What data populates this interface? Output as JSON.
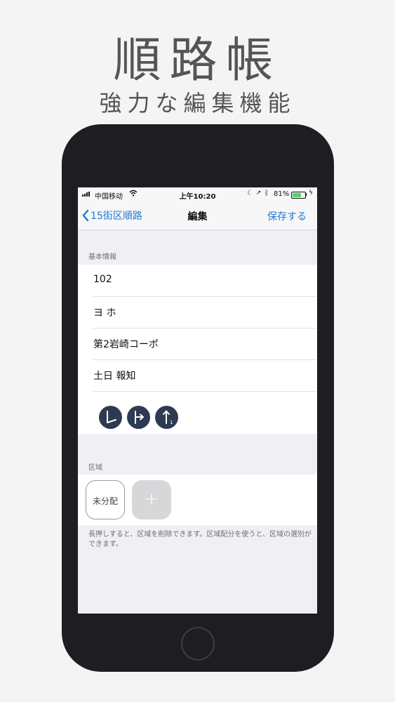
{
  "promo": {
    "title": "順路帳",
    "subtitle": "強力な編集機能"
  },
  "status_bar": {
    "carrier": "中国移动",
    "time": "上午10:20",
    "battery": "81%",
    "battery_level": 0.81,
    "icons": [
      "signal-icon",
      "wifi-icon",
      "moon-icon",
      "location-icon",
      "bluetooth-icon",
      "battery-icon",
      "charging-icon"
    ]
  },
  "nav": {
    "back_label": "15街区順路",
    "title": "編集",
    "save_label": "保存する"
  },
  "basic_info": {
    "header": "基本情報",
    "rows": [
      "102",
      "ヨ ホ",
      "第2岩崎コーポ",
      "土日 報知"
    ],
    "direction_icons": [
      "turn-left-icon",
      "turn-right-icon",
      "go-straight-icon"
    ]
  },
  "area": {
    "header": "区域",
    "unassigned_label": "未分配",
    "add_label": "+",
    "footnote": "長押しすると、区域を削除できます。区域配分を使うと、区域の選別ができます。"
  },
  "colors": {
    "accent": "#1e7ad8",
    "icon_bg": "#2d3a52",
    "battery": "#4cd964"
  }
}
